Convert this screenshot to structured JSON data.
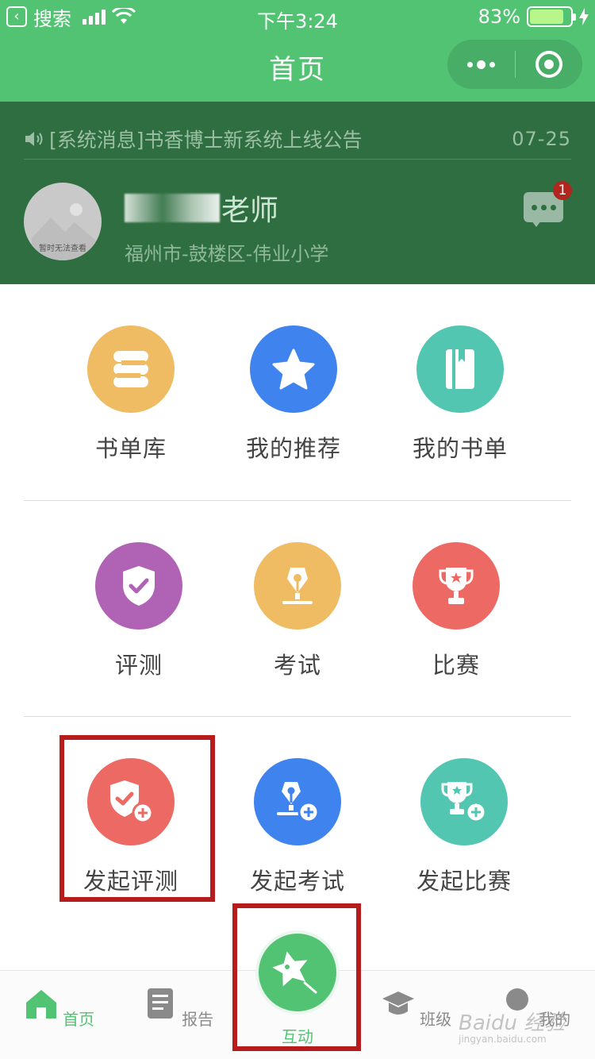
{
  "status_bar": {
    "back_app": "搜索",
    "time": "下午3:24",
    "battery": "83%",
    "battery_level": 0.83
  },
  "nav": {
    "title": "首页"
  },
  "notice": {
    "text": "[系统消息]书香博士新系统上线公告",
    "date": "07-25"
  },
  "profile": {
    "name_suffix": "老师",
    "school": "福州市-鼓楼区-伟业小学",
    "avatar_caption": "暂时无法查看",
    "unread_count": "1"
  },
  "grid_row1": [
    {
      "label": "书单库",
      "icon": "book-list-icon",
      "color": "#efbb63"
    },
    {
      "label": "我的推荐",
      "icon": "star-icon",
      "color": "#3f83ef"
    },
    {
      "label": "我的书单",
      "icon": "book-icon",
      "color": "#53c6b2"
    }
  ],
  "grid_row2": [
    {
      "label": "评测",
      "icon": "shield-check-icon",
      "color": "#b063b5"
    },
    {
      "label": "考试",
      "icon": "pen-nib-icon",
      "color": "#efbb63"
    },
    {
      "label": "比赛",
      "icon": "trophy-icon",
      "color": "#ec6a63"
    }
  ],
  "grid_row3": [
    {
      "label": "发起评测",
      "icon": "shield-plus-icon",
      "color": "#ec6a63"
    },
    {
      "label": "发起考试",
      "icon": "pen-plus-icon",
      "color": "#3f83ef"
    },
    {
      "label": "发起比赛",
      "icon": "trophy-plus-icon",
      "color": "#53c6b2"
    }
  ],
  "tabs": [
    {
      "label": "首页",
      "icon": "home-icon",
      "active": true
    },
    {
      "label": "报告",
      "icon": "report-icon",
      "active": false
    },
    {
      "label": "互动",
      "icon": "star-wand-icon",
      "active": true
    },
    {
      "label": "班级",
      "icon": "graduation-cap-icon",
      "active": false
    },
    {
      "label": "我的",
      "icon": "user-icon",
      "active": false
    }
  ],
  "watermark": {
    "brand": "Baidu 经验",
    "url": "jingyan.baidu.com"
  },
  "colors": {
    "primary_green": "#52c373",
    "header_dark_green": "#2e6e40",
    "highlight_red": "#b71c1c"
  }
}
